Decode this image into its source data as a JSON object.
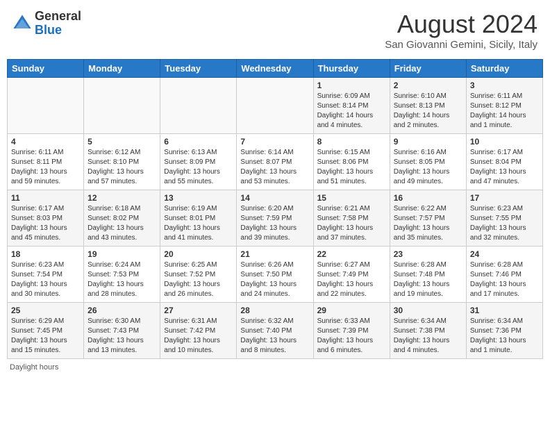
{
  "header": {
    "logo_general": "General",
    "logo_blue": "Blue",
    "main_title": "August 2024",
    "subtitle": "San Giovanni Gemini, Sicily, Italy"
  },
  "columns": [
    "Sunday",
    "Monday",
    "Tuesday",
    "Wednesday",
    "Thursday",
    "Friday",
    "Saturday"
  ],
  "weeks": [
    [
      {
        "day": "",
        "info": ""
      },
      {
        "day": "",
        "info": ""
      },
      {
        "day": "",
        "info": ""
      },
      {
        "day": "",
        "info": ""
      },
      {
        "day": "1",
        "info": "Sunrise: 6:09 AM\nSunset: 8:14 PM\nDaylight: 14 hours\nand 4 minutes."
      },
      {
        "day": "2",
        "info": "Sunrise: 6:10 AM\nSunset: 8:13 PM\nDaylight: 14 hours\nand 2 minutes."
      },
      {
        "day": "3",
        "info": "Sunrise: 6:11 AM\nSunset: 8:12 PM\nDaylight: 14 hours\nand 1 minute."
      }
    ],
    [
      {
        "day": "4",
        "info": "Sunrise: 6:11 AM\nSunset: 8:11 PM\nDaylight: 13 hours\nand 59 minutes."
      },
      {
        "day": "5",
        "info": "Sunrise: 6:12 AM\nSunset: 8:10 PM\nDaylight: 13 hours\nand 57 minutes."
      },
      {
        "day": "6",
        "info": "Sunrise: 6:13 AM\nSunset: 8:09 PM\nDaylight: 13 hours\nand 55 minutes."
      },
      {
        "day": "7",
        "info": "Sunrise: 6:14 AM\nSunset: 8:07 PM\nDaylight: 13 hours\nand 53 minutes."
      },
      {
        "day": "8",
        "info": "Sunrise: 6:15 AM\nSunset: 8:06 PM\nDaylight: 13 hours\nand 51 minutes."
      },
      {
        "day": "9",
        "info": "Sunrise: 6:16 AM\nSunset: 8:05 PM\nDaylight: 13 hours\nand 49 minutes."
      },
      {
        "day": "10",
        "info": "Sunrise: 6:17 AM\nSunset: 8:04 PM\nDaylight: 13 hours\nand 47 minutes."
      }
    ],
    [
      {
        "day": "11",
        "info": "Sunrise: 6:17 AM\nSunset: 8:03 PM\nDaylight: 13 hours\nand 45 minutes."
      },
      {
        "day": "12",
        "info": "Sunrise: 6:18 AM\nSunset: 8:02 PM\nDaylight: 13 hours\nand 43 minutes."
      },
      {
        "day": "13",
        "info": "Sunrise: 6:19 AM\nSunset: 8:01 PM\nDaylight: 13 hours\nand 41 minutes."
      },
      {
        "day": "14",
        "info": "Sunrise: 6:20 AM\nSunset: 7:59 PM\nDaylight: 13 hours\nand 39 minutes."
      },
      {
        "day": "15",
        "info": "Sunrise: 6:21 AM\nSunset: 7:58 PM\nDaylight: 13 hours\nand 37 minutes."
      },
      {
        "day": "16",
        "info": "Sunrise: 6:22 AM\nSunset: 7:57 PM\nDaylight: 13 hours\nand 35 minutes."
      },
      {
        "day": "17",
        "info": "Sunrise: 6:23 AM\nSunset: 7:55 PM\nDaylight: 13 hours\nand 32 minutes."
      }
    ],
    [
      {
        "day": "18",
        "info": "Sunrise: 6:23 AM\nSunset: 7:54 PM\nDaylight: 13 hours\nand 30 minutes."
      },
      {
        "day": "19",
        "info": "Sunrise: 6:24 AM\nSunset: 7:53 PM\nDaylight: 13 hours\nand 28 minutes."
      },
      {
        "day": "20",
        "info": "Sunrise: 6:25 AM\nSunset: 7:52 PM\nDaylight: 13 hours\nand 26 minutes."
      },
      {
        "day": "21",
        "info": "Sunrise: 6:26 AM\nSunset: 7:50 PM\nDaylight: 13 hours\nand 24 minutes."
      },
      {
        "day": "22",
        "info": "Sunrise: 6:27 AM\nSunset: 7:49 PM\nDaylight: 13 hours\nand 22 minutes."
      },
      {
        "day": "23",
        "info": "Sunrise: 6:28 AM\nSunset: 7:48 PM\nDaylight: 13 hours\nand 19 minutes."
      },
      {
        "day": "24",
        "info": "Sunrise: 6:28 AM\nSunset: 7:46 PM\nDaylight: 13 hours\nand 17 minutes."
      }
    ],
    [
      {
        "day": "25",
        "info": "Sunrise: 6:29 AM\nSunset: 7:45 PM\nDaylight: 13 hours\nand 15 minutes."
      },
      {
        "day": "26",
        "info": "Sunrise: 6:30 AM\nSunset: 7:43 PM\nDaylight: 13 hours\nand 13 minutes."
      },
      {
        "day": "27",
        "info": "Sunrise: 6:31 AM\nSunset: 7:42 PM\nDaylight: 13 hours\nand 10 minutes."
      },
      {
        "day": "28",
        "info": "Sunrise: 6:32 AM\nSunset: 7:40 PM\nDaylight: 13 hours\nand 8 minutes."
      },
      {
        "day": "29",
        "info": "Sunrise: 6:33 AM\nSunset: 7:39 PM\nDaylight: 13 hours\nand 6 minutes."
      },
      {
        "day": "30",
        "info": "Sunrise: 6:34 AM\nSunset: 7:38 PM\nDaylight: 13 hours\nand 4 minutes."
      },
      {
        "day": "31",
        "info": "Sunrise: 6:34 AM\nSunset: 7:36 PM\nDaylight: 13 hours\nand 1 minute."
      }
    ]
  ],
  "footer": {
    "note": "Daylight hours"
  }
}
